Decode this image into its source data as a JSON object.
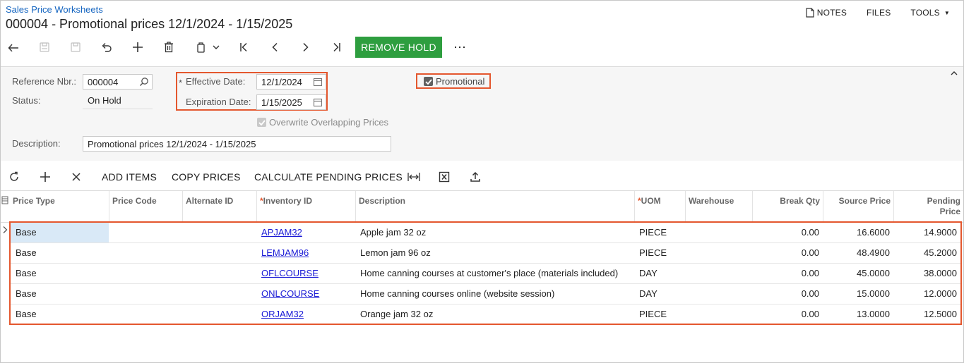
{
  "breadcrumb": "Sales Price Worksheets",
  "title": "000004 - Promotional prices 12/1/2024 - 1/15/2025",
  "top_links": {
    "notes": "NOTES",
    "files": "FILES",
    "tools": "TOOLS"
  },
  "toolbar": {
    "icons": [
      "back-icon",
      "save-close-icon",
      "save-icon",
      "undo-icon",
      "add-icon",
      "delete-icon",
      "copy-paste-icon",
      "first-icon",
      "prev-icon",
      "next-icon",
      "last-icon"
    ],
    "remove_hold": "REMOVE HOLD",
    "more": "⋯"
  },
  "form": {
    "reference_nbr_label": "Reference Nbr.:",
    "reference_nbr": "000004",
    "status_label": "Status:",
    "status": "On Hold",
    "effective_date_label": "Effective Date:",
    "effective_date": "12/1/2024",
    "expiration_date_label": "Expiration Date:",
    "expiration_date": "1/15/2025",
    "promotional_label": "Promotional",
    "promotional_checked": true,
    "overwrite_label": "Overwrite Overlapping Prices",
    "overwrite_checked": true,
    "description_label": "Description:",
    "description": "Promotional prices 12/1/2024 - 1/15/2025",
    "required_marker": "*"
  },
  "grid_toolbar": {
    "add_items": "ADD ITEMS",
    "copy_prices": "COPY PRICES",
    "calculate_pending": "CALCULATE PENDING PRICES"
  },
  "grid": {
    "columns": {
      "price_type": "Price Type",
      "price_code": "Price Code",
      "alternate_id": "Alternate ID",
      "inventory_id": "Inventory ID",
      "description": "Description",
      "uom": "UOM",
      "warehouse": "Warehouse",
      "break_qty": "Break Qty",
      "source_price": "Source Price",
      "pending_price_1": "Pending",
      "pending_price_2": "Price"
    },
    "rows": [
      {
        "price_type": "Base",
        "price_code": "",
        "alternate_id": "",
        "inventory_id": "APJAM32",
        "description": "Apple jam 32 oz",
        "uom": "PIECE",
        "warehouse": "",
        "break_qty": "0.00",
        "source_price": "16.6000",
        "pending_price": "14.9000"
      },
      {
        "price_type": "Base",
        "price_code": "",
        "alternate_id": "",
        "inventory_id": "LEMJAM96",
        "description": "Lemon jam 96 oz",
        "uom": "PIECE",
        "warehouse": "",
        "break_qty": "0.00",
        "source_price": "48.4900",
        "pending_price": "45.2000"
      },
      {
        "price_type": "Base",
        "price_code": "",
        "alternate_id": "",
        "inventory_id": "OFLCOURSE",
        "description": "Home canning courses at customer's place (materials included)",
        "uom": "DAY",
        "warehouse": "",
        "break_qty": "0.00",
        "source_price": "45.0000",
        "pending_price": "38.0000"
      },
      {
        "price_type": "Base",
        "price_code": "",
        "alternate_id": "",
        "inventory_id": "ONLCOURSE",
        "description": "Home canning courses online (website session)",
        "uom": "DAY",
        "warehouse": "",
        "break_qty": "0.00",
        "source_price": "15.0000",
        "pending_price": "12.0000"
      },
      {
        "price_type": "Base",
        "price_code": "",
        "alternate_id": "",
        "inventory_id": "ORJAM32",
        "description": "Orange jam 32 oz",
        "uom": "PIECE",
        "warehouse": "",
        "break_qty": "0.00",
        "source_price": "13.0000",
        "pending_price": "12.5000"
      }
    ]
  },
  "colors": {
    "accent": "#2e9e3f",
    "link": "#1565c0",
    "highlight": "#e4572e"
  }
}
